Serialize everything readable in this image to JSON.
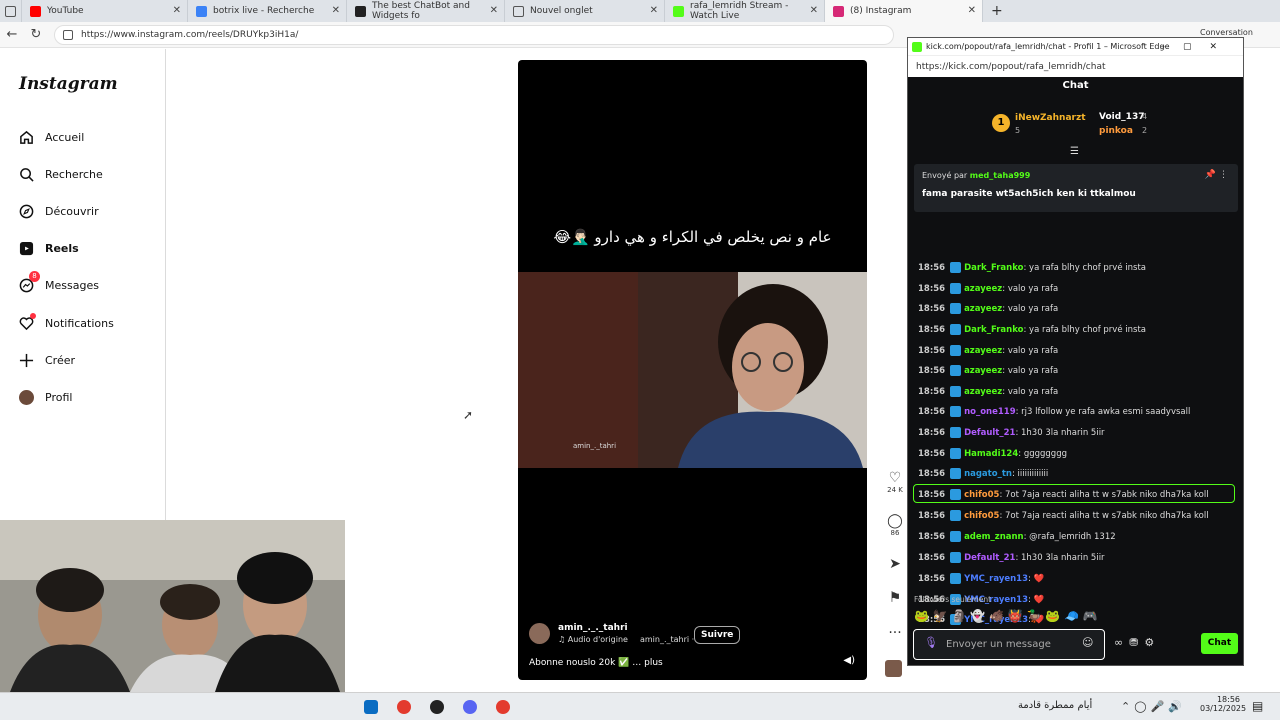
{
  "browser": {
    "tabs": [
      {
        "title": "YouTube",
        "color": "#ff0000"
      },
      {
        "title": "botrix live - Recherche",
        "color": "#3b82f6"
      },
      {
        "title": "The best ChatBot and Widgets fo",
        "color": "#222222"
      },
      {
        "title": "Nouvel onglet",
        "color": "#555555"
      },
      {
        "title": "rafa_lemridh Stream - Watch Live",
        "color": "#53fc18"
      },
      {
        "title": "(8) Instagram",
        "color": "#d62976"
      }
    ],
    "url": "https://www.instagram.com/reels/DRUYkp3iH1a/",
    "right_label": "Conversation"
  },
  "instagram": {
    "logo": "Instagram",
    "nav": [
      {
        "label": "Accueil",
        "icon": "home-icon"
      },
      {
        "label": "Recherche",
        "icon": "search-icon"
      },
      {
        "label": "Découvrir",
        "icon": "compass-icon"
      },
      {
        "label": "Reels",
        "icon": "reels-icon"
      },
      {
        "label": "Messages",
        "icon": "messenger-icon",
        "badge": "8"
      },
      {
        "label": "Notifications",
        "icon": "heart-icon"
      },
      {
        "label": "Créer",
        "icon": "plus-icon"
      },
      {
        "label": "Profil",
        "icon": "profile-avatar"
      }
    ],
    "reel": {
      "caption": "عام و نص يخلص في الكراء و هي دارو 🤦🏻‍♂️😂",
      "watermark": "amin_._tahri",
      "author": "amin_._._tahri",
      "audio": "Audio d'origine",
      "audio_author": "amin_._tahri ·",
      "follow": "Suivre",
      "description": "Abonne nouslo 20k ✅ … plus"
    },
    "actions": {
      "likes": "24 K",
      "comments": "86"
    }
  },
  "kick": {
    "window_title": "kick.com/popout/rafa_lemridh/chat - Profil 1 – Microsoft Edge",
    "url": "https://kick.com/popout/rafa_lemridh/chat",
    "chat_header": "Chat",
    "leaderboard": [
      {
        "rank": "1",
        "user": "iNewZahnarzt",
        "count": "5"
      },
      {
        "user": "Void_137",
        "count": "4"
      },
      {
        "user": "pinkoa",
        "count": "2"
      }
    ],
    "pinned": {
      "sent_by": "Envoyé par",
      "user": "med_taha999",
      "message": "fama parasite wt5ach5ich ken ki ttkalmou"
    },
    "messages": [
      {
        "time": "18:56",
        "user": "Dark_Franko",
        "color": "#53fc18",
        "text": ": ya rafa blhy chof prvé insta"
      },
      {
        "time": "18:56",
        "user": "azayeez",
        "color": "#53fc18",
        "text": ": valo ya rafa"
      },
      {
        "time": "18:56",
        "user": "azayeez",
        "color": "#53fc18",
        "text": ": valo ya rafa"
      },
      {
        "time": "18:56",
        "user": "Dark_Franko",
        "color": "#53fc18",
        "text": ": ya rafa blhy chof prvé insta"
      },
      {
        "time": "18:56",
        "user": "azayeez",
        "color": "#53fc18",
        "text": ": valo ya rafa"
      },
      {
        "time": "18:56",
        "user": "azayeez",
        "color": "#53fc18",
        "text": ": valo ya rafa"
      },
      {
        "time": "18:56",
        "user": "azayeez",
        "color": "#53fc18",
        "text": ": valo ya rafa"
      },
      {
        "time": "18:56",
        "user": "no_one119",
        "color": "#b05cff",
        "text": ": rj3 lfollow ye rafa awka esmi saadyvsall"
      },
      {
        "time": "18:56",
        "user": "Default_21",
        "color": "#b05cff",
        "text": ": 1h30 3la nharin 5iir"
      },
      {
        "time": "18:56",
        "user": "Hamadi124",
        "color": "#53fc18",
        "text": ": gggggggg"
      },
      {
        "time": "18:56",
        "user": "nagato_tn",
        "color": "#2b9adf",
        "text": ": iiiiiiiiiiiii"
      },
      {
        "time": "18:56",
        "user": "chifo05",
        "color": "#ff9b3d",
        "text": ": 7ot 7aja reacti aliha tt w s7abk niko dha7ka koll"
      },
      {
        "time": "18:56",
        "user": "chifo05",
        "color": "#ff9b3d",
        "text": ": 7ot 7aja reacti aliha tt w s7abk niko dha7ka koll"
      },
      {
        "time": "18:56",
        "user": "adem_znann",
        "color": "#53fc18",
        "text": ": @rafa_lemridh 1312"
      },
      {
        "time": "18:56",
        "user": "Default_21",
        "color": "#b05cff",
        "text": ": 1h30 3la nharin 5iir"
      },
      {
        "time": "18:56",
        "user": "YMC_rayen13",
        "color": "#4c7dff",
        "text": ": ❤️"
      },
      {
        "time": "18:56",
        "user": "YMC_rayen13",
        "color": "#4c7dff",
        "text": ": ❤️"
      },
      {
        "time": "18:56",
        "user": "YMC_rayen13",
        "color": "#4c7dff",
        "text": ": ❤️"
      }
    ],
    "followers_only": "Followers seulement",
    "input_placeholder": "Envoyer un message",
    "send": "Chat"
  },
  "taskbar": {
    "weather": "أيام ممطرة قادمة",
    "time": "18:56",
    "date": "03/12/2025"
  }
}
